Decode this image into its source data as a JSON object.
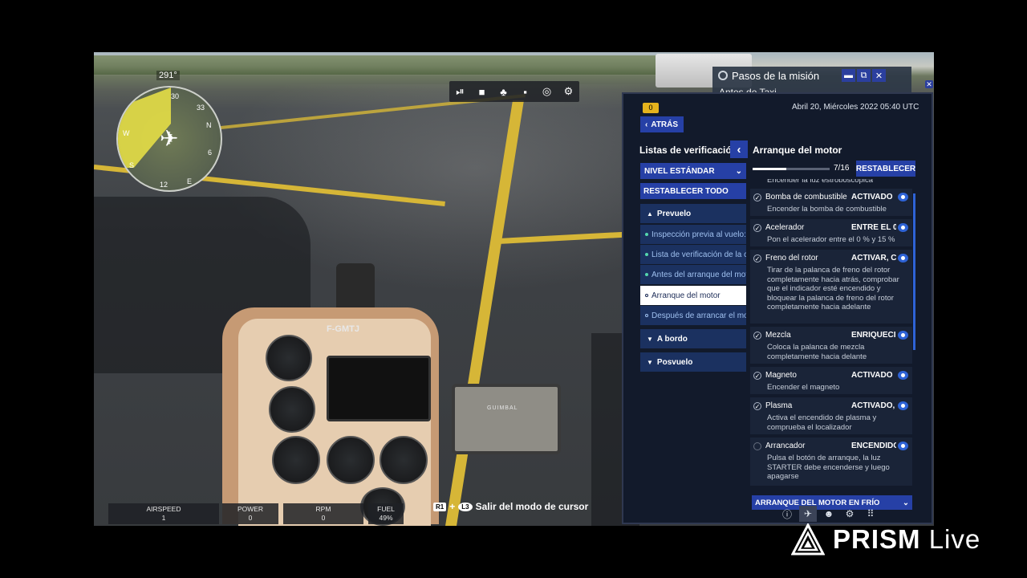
{
  "hud": {
    "heading": "291°",
    "compass": {
      "n": "N",
      "e": "E",
      "s": "S",
      "w": "W",
      "t30": "30",
      "t33": "33",
      "t6": "6",
      "t12": "12"
    },
    "instruments": [
      {
        "label": "AIRSPEED",
        "value": "1"
      },
      {
        "label": "POWER",
        "value": "0"
      },
      {
        "label": "RPM",
        "value": "0"
      },
      {
        "label": "FUEL",
        "value": "49%"
      }
    ],
    "cursor_hint": {
      "key1": "R1",
      "plus": "+",
      "key2": "L3",
      "text": "Salir del modo de cursor"
    },
    "registration": "F-GMTJ",
    "brand_plate": "GUIMBAL"
  },
  "toolbar": {
    "icons": [
      "play-pause-icon",
      "camera-icon",
      "gamepad-icon",
      "chat-icon",
      "target-icon",
      "gear-icon"
    ],
    "glyphs": [
      "⏯",
      "■",
      "♣",
      "▪",
      "◎",
      "⚙"
    ]
  },
  "mission_window": {
    "title": "Pasos de la misión",
    "subtitle": "Antes de Taxi",
    "minimize": "▬",
    "popout": "⧉",
    "close": "✕"
  },
  "checklist": {
    "notification_count": "0",
    "datetime": "Abril 20, Miércoles 2022 05:40 UTC",
    "back_label": "ATRÁS",
    "left_title": "Listas de verificación",
    "level_label": "NIVEL ESTÁNDAR",
    "reset_all_label": "RESTABLECER TODO",
    "sections": {
      "prevuelo": "Prevuelo",
      "a_bordo": "A bordo",
      "posvuelo": "Posvuelo"
    },
    "subitems": [
      "Inspección previa al vuelo: c",
      "Lista de verificación de la c",
      "Antes del arranque del mot",
      "Arranque del motor",
      "Después de arrancar el mo"
    ],
    "right_title": "Arranque del motor",
    "progress": {
      "fraction": 0.4375,
      "text": "7/16"
    },
    "reset_label": "RESTABLECER",
    "partial_top": "Encender la luz estroboscópica",
    "items": [
      {
        "name": "Bomba de combustible",
        "state": "ACTIVADO",
        "desc": "Encender la bomba de combustible",
        "checked": true
      },
      {
        "name": "Acelerador",
        "state": "ENTRE EL 0",
        "desc": "Pon el acelerador entre el 0 % y 15 %",
        "checked": true
      },
      {
        "name": "Freno del rotor",
        "state": "ACTIVAR, C",
        "desc": "Tirar de la palanca de freno del rotor completamente hacia atrás, comprobar que el indicador esté encendido y bloquear la palanca de freno del rotor completamente hacia adelante",
        "checked": true
      },
      {
        "name": "Mezcla",
        "state": "ENRIQUECIM",
        "desc": "Coloca la palanca de mezcla completamente hacia delante",
        "checked": true
      },
      {
        "name": "Magneto",
        "state": "ACTIVADO",
        "desc": "Encender el magneto",
        "checked": true
      },
      {
        "name": "Plasma",
        "state": "ACTIVADO,",
        "desc": "Activa el encendido de plasma y comprueba el localizador",
        "checked": true
      },
      {
        "name": "Arrancador",
        "state": "ENCENDIDO",
        "desc": "Pulsa el botón de arranque, la luz STARTER debe encenderse y luego apagarse",
        "checked": false
      }
    ],
    "bottom_section": "ARRANQUE DEL MOTOR EN FRÍO",
    "bottom_tabs": [
      "info-icon",
      "plane-icon",
      "pilot-icon",
      "gear-icon",
      "grid-icon"
    ],
    "bottom_glyphs": [
      "ⓘ",
      "✈",
      "☻",
      "⚙",
      "⠿"
    ]
  },
  "watermark": {
    "brand": "PRISM",
    "suffix": "Live"
  }
}
